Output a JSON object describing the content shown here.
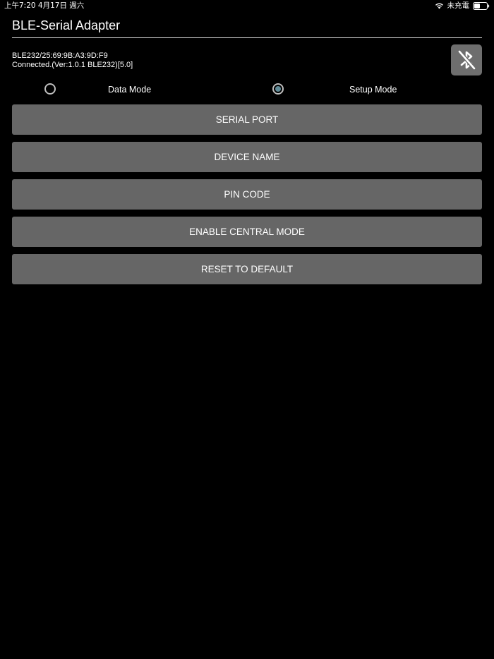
{
  "status_bar": {
    "time_date": "上午7:20   4月17日 週六",
    "charging_status": "未充電",
    "icons": [
      "wifi-icon",
      "battery-icon"
    ]
  },
  "app": {
    "title": "BLE-Serial Adapter"
  },
  "device": {
    "address": "BLE232/25:69:9B:A3:9D:F9",
    "status": "Connected.(Ver:1.0.1 BLE232)[5.0]"
  },
  "bluetooth_button": {
    "icon": "bluetooth-disabled-icon",
    "bg_color": "#6e6e6e"
  },
  "modes": {
    "selected": "setup",
    "data_mode_label": "Data Mode",
    "setup_mode_label": "Setup Mode",
    "accent_color": "#5f8a96"
  },
  "menu": {
    "serial_port": "SERIAL PORT",
    "device_name": "DEVICE NAME",
    "pin_code": "PIN CODE",
    "enable_central_mode": "ENABLE CENTRAL MODE",
    "reset_to_default": "RESET TO DEFAULT",
    "button_color": "#666666"
  }
}
